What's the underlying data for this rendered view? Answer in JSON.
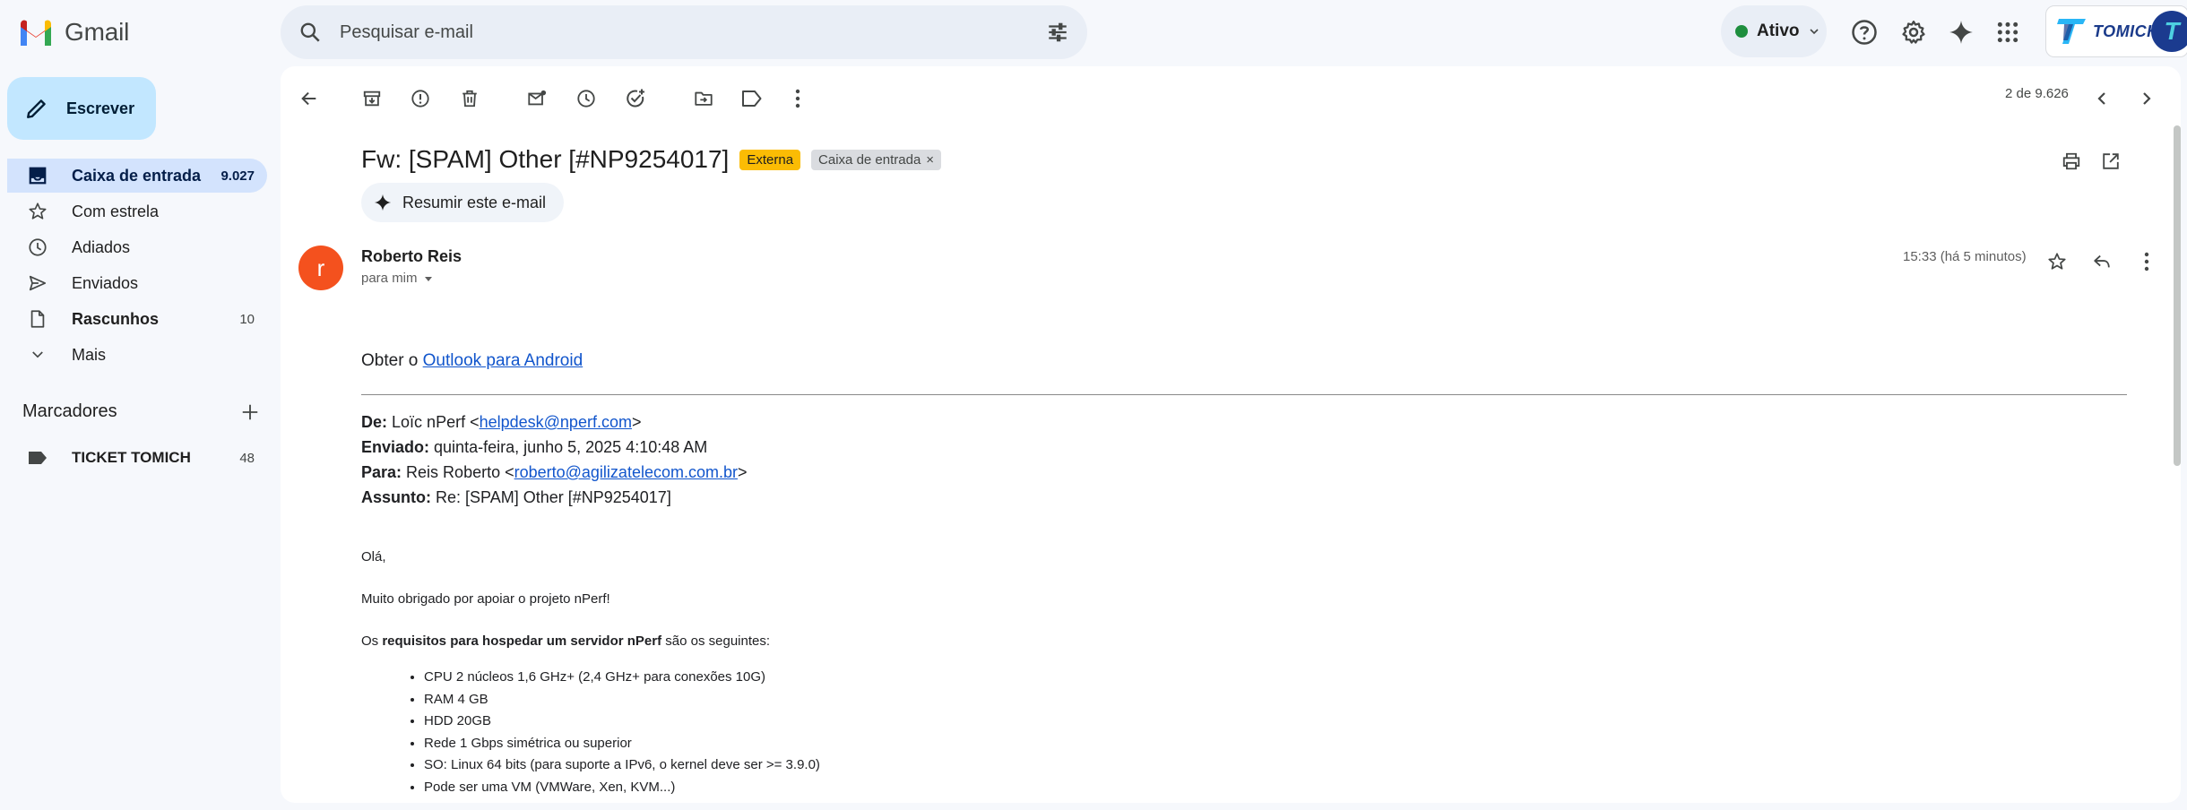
{
  "app": {
    "name": "Gmail"
  },
  "search": {
    "placeholder": "Pesquisar e-mail"
  },
  "status": {
    "label": "Ativo"
  },
  "brand": {
    "name": "TOMICH",
    "avatar_letter": "T"
  },
  "compose": {
    "label": "Escrever"
  },
  "sidebar": {
    "items": [
      {
        "label": "Caixa de entrada",
        "count": "9.027",
        "icon": "inbox-icon"
      },
      {
        "label": "Com estrela",
        "count": "",
        "icon": "star-icon"
      },
      {
        "label": "Adiados",
        "count": "",
        "icon": "clock-icon"
      },
      {
        "label": "Enviados",
        "count": "",
        "icon": "send-icon"
      },
      {
        "label": "Rascunhos",
        "count": "10",
        "icon": "draft-icon"
      },
      {
        "label": "Mais",
        "count": "",
        "icon": "chevron-down-icon"
      }
    ],
    "labels_heading": "Marcadores",
    "labels": [
      {
        "label": "TICKET TOMICH",
        "count": "48"
      }
    ]
  },
  "toolbar": {
    "pager": "2 de 9.626"
  },
  "email": {
    "subject": "Fw: [SPAM] Other [#NP9254017]",
    "chip_external": "Externa",
    "chip_inbox": "Caixa de entrada",
    "summarize": "Resumir este e-mail",
    "avatar_letter": "r",
    "sender": "Roberto Reis",
    "to": "para mim",
    "time": "15:33 (há 5 minutos)",
    "body": {
      "intro_prefix": "Obter o",
      "intro_link": "Outlook para Android",
      "from_label": "De:",
      "from_name": "Loïc nPerf <",
      "from_email": "helpdesk@nperf.com",
      "from_close": ">",
      "sent_label": "Enviado:",
      "sent_value": "quinta-feira, junho 5, 2025 4:10:48 AM",
      "to_label": "Para:",
      "to_name": "Reis Roberto <",
      "to_email": "roberto@agilizatelecom.com.br",
      "to_close": ">",
      "subject_label": "Assunto:",
      "subject_value": "Re: [SPAM] Other [#NP9254017]",
      "greeting": "Olá,",
      "thanks": "Muito obrigado por apoiar o projeto nPerf!",
      "req_prefix": "Os",
      "req_bold": "requisitos para hospedar um servidor nPerf",
      "req_suffix": "são os seguintes:",
      "requirements": [
        "CPU 2 núcleos 1,6 GHz+ (2,4 GHz+ para conexões 10G)",
        "RAM 4 GB",
        "HDD 20GB",
        "Rede 1 Gbps simétrica ou superior",
        "SO: Linux 64 bits (para suporte a IPv6, o kernel deve ser >= 3.9.0)",
        "Pode ser uma VM (VMWare, Xen, KVM...)"
      ]
    }
  },
  "colors": {
    "compose_bg": "#c2e7ff",
    "active_nav": "#d3e3fd",
    "chip_external": "#fbbc04",
    "avatar": "#f4511e",
    "link": "#1155cc"
  }
}
